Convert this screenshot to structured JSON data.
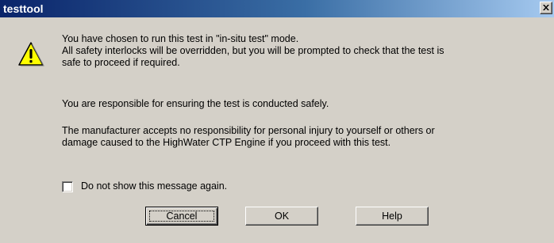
{
  "window": {
    "title": "testtool"
  },
  "message": {
    "line1": "You have chosen to run this test in \"in-situ test\" mode.",
    "line2": "All safety interlocks will be overridden, but you will be prompted to check that the test is",
    "line3": "safe to proceed if required.",
    "line4": "You are responsible for ensuring the test is conducted safely.",
    "line5": "The manufacturer accepts no responsibility for personal injury to yourself or others or",
    "line6": "damage caused to the HighWater CTP Engine if you proceed with this test."
  },
  "checkbox": {
    "label": "Do not show this message again.",
    "checked": false
  },
  "buttons": {
    "cancel": "Cancel",
    "ok": "OK",
    "help": "Help"
  },
  "icons": {
    "warning": "warning-icon",
    "close": "close-icon"
  },
  "colors": {
    "title_bar_start": "#0a246a",
    "title_bar_end": "#a6caf0",
    "dialog_bg": "#d4d0c8",
    "warning_fill": "#ffff00"
  }
}
